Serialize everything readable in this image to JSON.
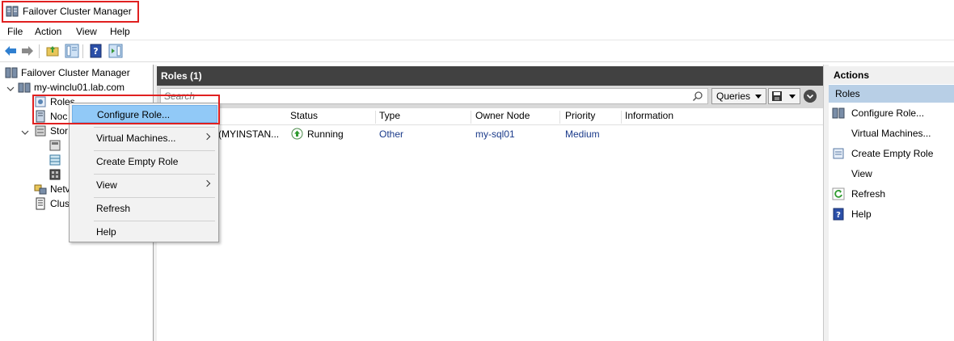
{
  "window": {
    "title": "Failover Cluster Manager"
  },
  "menu": {
    "items": [
      "File",
      "Action",
      "View",
      "Help"
    ]
  },
  "tree": {
    "root": "Failover Cluster Manager",
    "cluster": "my-winclu01.lab.com",
    "roles": "Roles",
    "nodes": "Noc",
    "storage": "Stor",
    "networks": "Netv",
    "cluster_events": "Clus"
  },
  "center": {
    "title": "Roles (1)",
    "search_placeholder": "Search",
    "queries_label": "Queries",
    "columns": [
      "Status",
      "Type",
      "Owner Node",
      "Priority",
      "Information"
    ],
    "row": {
      "name_partial": "er (MYINSTAN...",
      "status": "Running",
      "type": "Other",
      "owner_node": "my-sql01",
      "priority": "Medium",
      "information": ""
    }
  },
  "actions": {
    "title": "Actions",
    "section": "Roles",
    "items": [
      "Configure Role...",
      "Virtual Machines...",
      "Create Empty Role",
      "View",
      "Refresh",
      "Help"
    ]
  },
  "context_menu": {
    "items": [
      "Configure Role...",
      "Virtual Machines...",
      "Create Empty Role",
      "View",
      "Refresh",
      "Help"
    ]
  },
  "colors": {
    "highlight_box": "#e02020",
    "menu_highlight": "#91c9f7",
    "header_dark": "#414141",
    "actions_section": "#b8cfe6"
  }
}
